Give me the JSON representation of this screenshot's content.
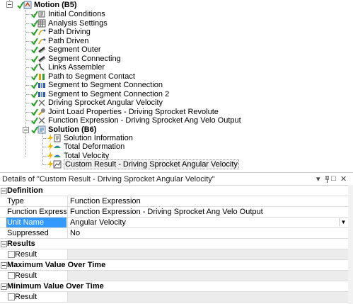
{
  "tree": {
    "root": {
      "label": "Motion (B5)"
    },
    "items": [
      {
        "label": "Initial Conditions",
        "icon": "initial-conditions-icon"
      },
      {
        "label": "Analysis Settings",
        "icon": "analysis-settings-icon"
      },
      {
        "label": "Path Driving",
        "icon": "path-icon"
      },
      {
        "label": "Path Driven",
        "icon": "path-icon"
      },
      {
        "label": "Segment Outer",
        "icon": "segment-icon"
      },
      {
        "label": "Segment Connecting",
        "icon": "segment-icon"
      },
      {
        "label": "Links Assembler",
        "icon": "links-assembler-icon"
      },
      {
        "label": "Path to Segment Contact",
        "icon": "contact-icon"
      },
      {
        "label": "Segment to Segment Connection",
        "icon": "connection-icon"
      },
      {
        "label": "Segment to Segment Connection 2",
        "icon": "connection-icon"
      },
      {
        "label": "Driving Sprocket Angular Velocity",
        "icon": "velocity-icon"
      },
      {
        "label": "Joint Load Properties - Driving Sprocket Revolute",
        "icon": "joint-load-icon"
      },
      {
        "label": "Function Expression - Driving Sprocket Ang Velo Output",
        "icon": "function-icon"
      }
    ],
    "solution": {
      "label": "Solution (B6)",
      "items": [
        {
          "label": "Solution Information",
          "icon": "solution-information-icon"
        },
        {
          "label": "Total Deformation",
          "icon": "deformation-icon"
        },
        {
          "label": "Total Velocity",
          "icon": "velocity-result-icon"
        },
        {
          "label": "Custom Result - Driving Sprocket Angular Velocity",
          "icon": "custom-result-icon"
        }
      ]
    }
  },
  "details": {
    "title": "Details of \"Custom Result - Driving Sprocket Angular Velocity\"",
    "buttons": {
      "dropdown": "▾",
      "pin": "📌",
      "restore": "□",
      "close": "✕"
    },
    "sections": [
      {
        "title": "Definition",
        "rows": [
          {
            "label": "Type",
            "value": "Function Expression"
          },
          {
            "label": "Function Expression",
            "value": "Function Expression - Driving Sprocket Ang Velo Output"
          },
          {
            "label": "Unit Name",
            "value": "Angular Velocity"
          },
          {
            "label": "Suppressed",
            "value": "No"
          }
        ]
      },
      {
        "title": "Results",
        "rows": [
          {
            "label": "Result",
            "value": ""
          }
        ]
      },
      {
        "title": "Maximum Value Over Time",
        "rows": [
          {
            "label": "Result",
            "value": ""
          }
        ]
      },
      {
        "title": "Minimum Value Over Time",
        "rows": [
          {
            "label": "Result",
            "value": ""
          }
        ]
      }
    ]
  },
  "colors": {
    "selection": "#3399ff",
    "check": "#22a022",
    "lightning": "#f2b800"
  }
}
